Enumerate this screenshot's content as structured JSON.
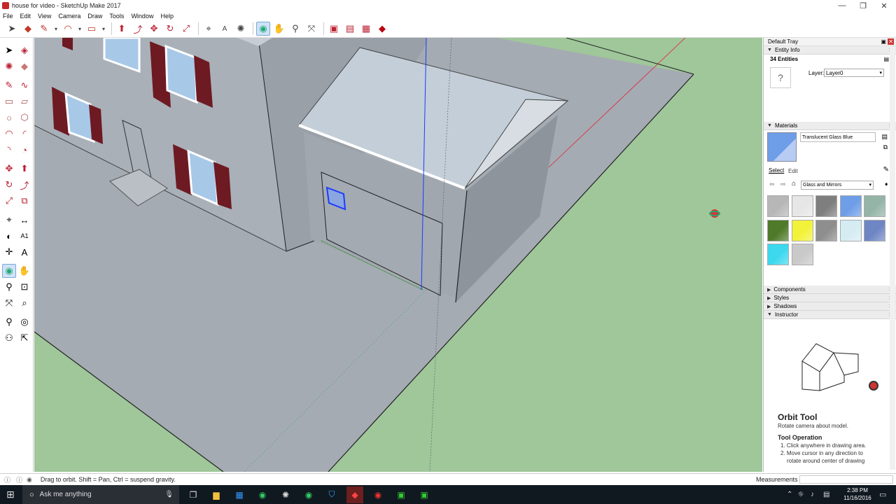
{
  "window": {
    "title": "house for video - SketchUp Make 2017",
    "minimize": "—",
    "maximize": "❐",
    "close": "✕"
  },
  "menu": [
    "File",
    "Edit",
    "View",
    "Camera",
    "Draw",
    "Tools",
    "Window",
    "Help"
  ],
  "toolbar": {
    "icons": [
      "select-icon",
      "eraser-icon",
      "pencil-icon",
      "dropdown",
      "arc-icon",
      "dropdown",
      "rectangle-icon",
      "dropdown",
      "push-pull-icon",
      "move-icon",
      "rotate-icon",
      "scale-icon",
      "offset-icon",
      "tape-measure-icon",
      "text-icon",
      "paint-bucket-icon",
      "orbit-icon",
      "pan-icon",
      "zoom-icon",
      "zoom-extents-icon",
      "warehouse-icon",
      "extension-warehouse-icon",
      "components-icon",
      "ruby-icon"
    ]
  },
  "status": {
    "hint": "Drag to orbit. Shift = Pan, Ctrl = suspend gravity.",
    "measurements_label": "Measurements"
  },
  "tray": {
    "title": "Default Tray",
    "entity_info": {
      "header": "Entity Info",
      "count": "34 Entities",
      "layer_label": "Layer:",
      "layer_value": "Layer0",
      "icon_glyph": "?"
    },
    "materials": {
      "header": "Materials",
      "current_name": "Translucent Glass Blue",
      "tab_select": "Select",
      "tab_edit": "Edit",
      "library": "Glass and Mirrors",
      "swatch_colors": [
        "#b7b7b7",
        "#e6e6e6",
        "#7e7e7e",
        "#6f9ee8",
        "#95b4a8",
        "#4e7a2a",
        "#f2f23a",
        "#8e8e8e",
        "#d5ecf3",
        "#6f86c4",
        "#3dd8ee",
        "#c9c9c9"
      ]
    },
    "collapsed_sections": [
      "Components",
      "Styles",
      "Shadows"
    ],
    "instructor": {
      "header": "Instructor",
      "tool_title": "Orbit Tool",
      "tool_desc": "Rotate camera about model.",
      "op_header": "Tool Operation",
      "steps": [
        "1. Click anywhere in drawing area.",
        "2. Move cursor in any direction to",
        "rotate around center of drawing"
      ]
    }
  },
  "taskbar": {
    "search_placeholder": "Ask me anything",
    "time": "2:38 PM",
    "date": "11/16/2016"
  },
  "colors": {
    "ground": "#9fc79a",
    "selection_blue": "#1a3cff",
    "accent": "#cfe3f7"
  }
}
